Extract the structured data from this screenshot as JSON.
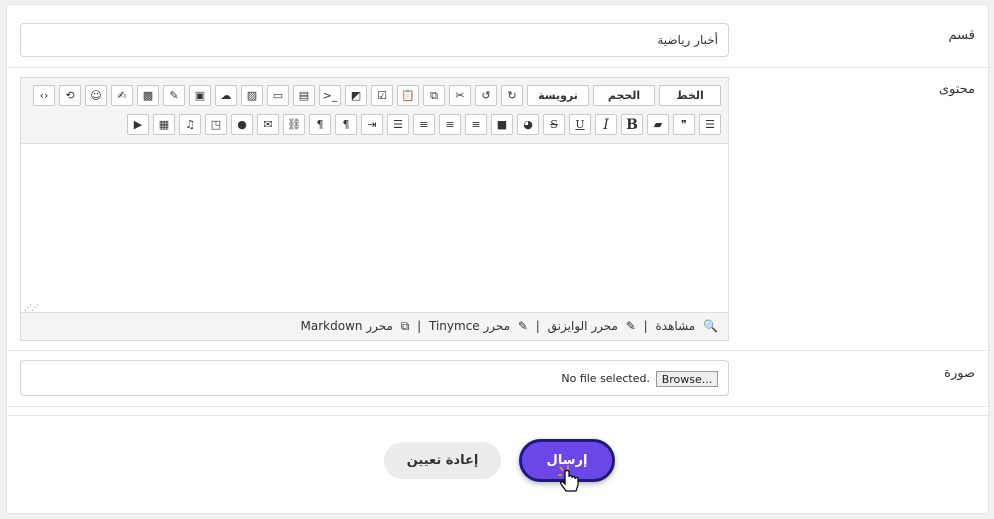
{
  "form": {
    "section_label": "قسم",
    "section_value": "أخبار رياضية",
    "content_label": "محتوى",
    "image_label": "صورة",
    "file_browse": "Browse...",
    "file_status": "No file selected."
  },
  "toolbar": {
    "font": "الخط",
    "size": "الحجم",
    "heading": "ترويسة",
    "bold": "B",
    "italic": "I",
    "underline": "U",
    "strike": "S",
    "html_code": "‹›",
    "terminal": ">_",
    "paragraph": "¶"
  },
  "editor_footer": {
    "preview": "مشاهدة",
    "wysiwyg": "محرر الوايزنق",
    "tinymce": "محرر Tinymce",
    "markdown": "محرر Markdown",
    "sep": "|"
  },
  "buttons": {
    "submit": "إرسال",
    "reset": "إعادة تعيين"
  }
}
